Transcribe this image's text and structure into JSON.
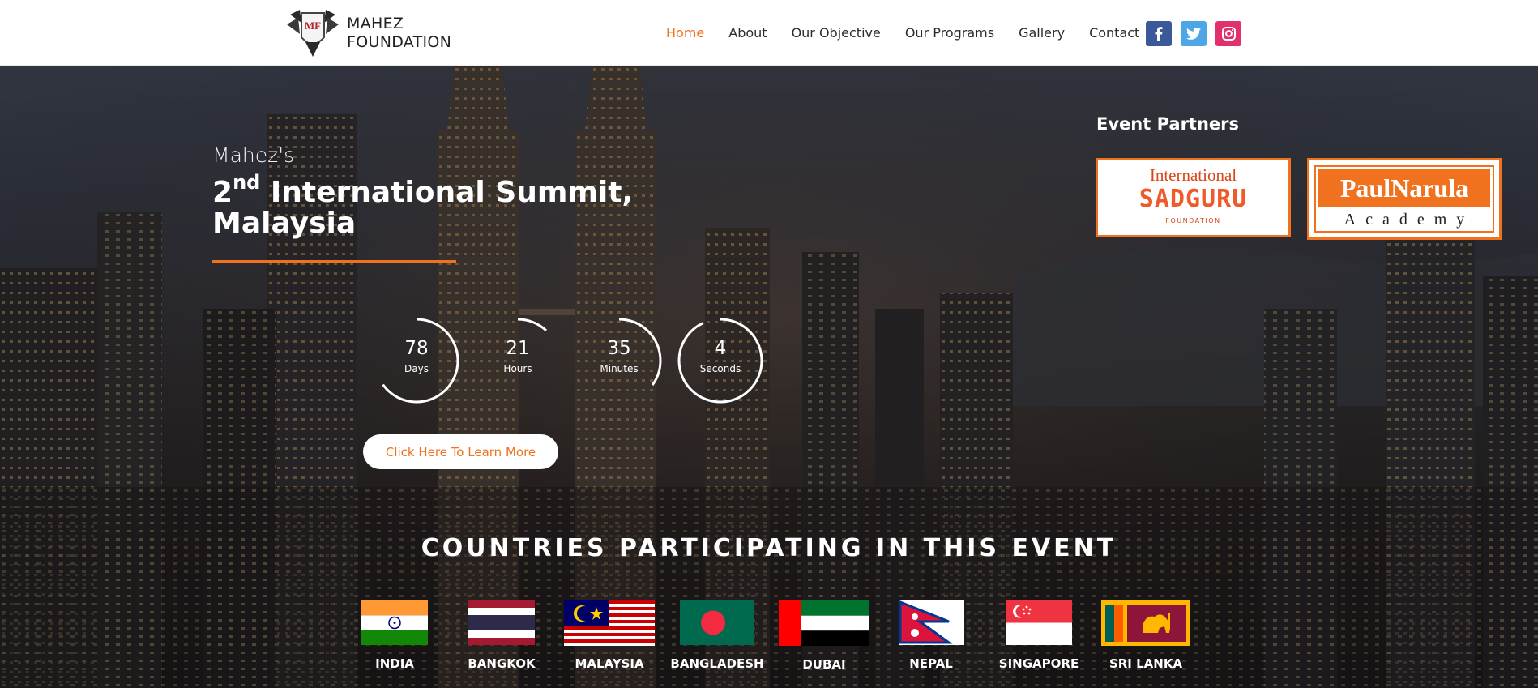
{
  "header": {
    "logo_lines": [
      "MAHEZ",
      "FOUNDATION"
    ],
    "logo_mark": "MF",
    "nav": [
      {
        "label": "Home",
        "active": true
      },
      {
        "label": "About",
        "active": false
      },
      {
        "label": "Our Objective",
        "active": false
      },
      {
        "label": "Our Programs",
        "active": false
      },
      {
        "label": "Gallery",
        "active": false
      },
      {
        "label": "Contact",
        "active": false
      }
    ],
    "social": [
      {
        "icon": "facebook-icon",
        "glyph": "f",
        "color": "#3b5998"
      },
      {
        "icon": "twitter-icon",
        "glyph": "t",
        "color": "#4ea6e6"
      },
      {
        "icon": "instagram-icon",
        "glyph": "◎",
        "color": "#e1306c"
      }
    ]
  },
  "hero": {
    "kicker": "Mahez's",
    "headline_ordinal": "2",
    "headline_suffix": "nd",
    "headline_rest": "International Summit,",
    "headline_line2": "Malaysia",
    "accent_color": "#f0711e",
    "countdown": [
      {
        "value": "78",
        "label": "Days",
        "progress": 0.65
      },
      {
        "value": "21",
        "label": "Hours",
        "progress": 0.12
      },
      {
        "value": "35",
        "label": "Minutes",
        "progress": 0.35
      },
      {
        "value": "4",
        "label": "Seconds",
        "progress": 0.93
      }
    ],
    "cta_label": "Click Here To Learn More"
  },
  "partners": {
    "title": "Event Partners",
    "sadguru": {
      "top": "International",
      "mid": "SADGURU",
      "bot": "FOUNDATION"
    },
    "paulnarula": {
      "top": "PaulNarula",
      "bot": "Academy"
    }
  },
  "countries": {
    "title": "COUNTRIES PARTICIPATING IN THIS EVENT",
    "items": [
      {
        "name": "INDIA",
        "flag": "india-flag"
      },
      {
        "name": "BANGKOK",
        "flag": "thailand-flag"
      },
      {
        "name": "MALAYSIA",
        "flag": "malaysia-flag"
      },
      {
        "name": "BANGLADESH",
        "flag": "bangladesh-flag"
      },
      {
        "name": "DUBAI",
        "flag": "uae-flag"
      },
      {
        "name": "NEPAL",
        "flag": "nepal-flag"
      },
      {
        "name": "SINGAPORE",
        "flag": "singapore-flag"
      },
      {
        "name": "SRI LANKA",
        "flag": "srilanka-flag"
      }
    ]
  }
}
